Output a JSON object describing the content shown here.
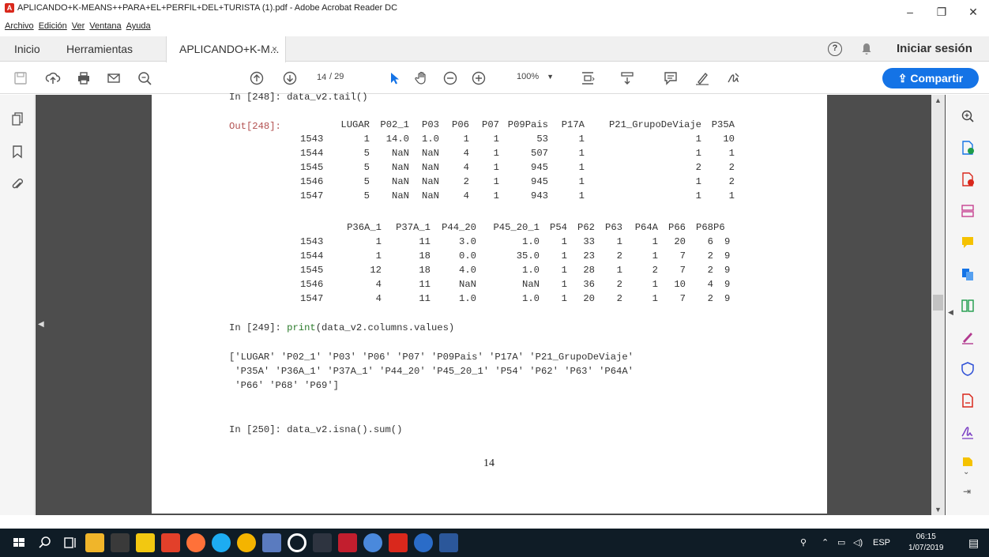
{
  "window": {
    "title": "APLICANDO+K-MEANS++PARA+EL+PERFIL+DEL+TURISTA (1).pdf - Adobe Acrobat Reader DC",
    "minimize": "–",
    "restore": "❐",
    "close": "✕"
  },
  "menu": [
    "Archivo",
    "Edición",
    "Ver",
    "Ventana",
    "Ayuda"
  ],
  "tabs": {
    "home": "Inicio",
    "tools": "Herramientas",
    "document": "APLICANDO+K-M...",
    "document_close": "×",
    "signin": "Iniciar sesión",
    "help": "?"
  },
  "toolbar": {
    "current_page": "14",
    "total_pages": "/ 29",
    "zoom": "100%",
    "share": "Compartir"
  },
  "document": {
    "line_tail_partial": "In [248]: data_v2.tail()",
    "out_label": "Out[248]:",
    "table1": {
      "headers": [
        "",
        "LUGAR",
        "P02_1",
        "P03",
        "P06",
        "P07",
        "P09Pais",
        "P17A",
        "P21_GrupoDeViaje",
        "P35A"
      ],
      "rows": [
        [
          "1543",
          "1",
          "14.0",
          "1.0",
          "1",
          "1",
          "53",
          "1",
          "1",
          "10"
        ],
        [
          "1544",
          "5",
          "NaN",
          "NaN",
          "4",
          "1",
          "507",
          "1",
          "1",
          "1"
        ],
        [
          "1545",
          "5",
          "NaN",
          "NaN",
          "4",
          "1",
          "945",
          "1",
          "2",
          "2"
        ],
        [
          "1546",
          "5",
          "NaN",
          "NaN",
          "2",
          "1",
          "945",
          "1",
          "1",
          "2"
        ],
        [
          "1547",
          "5",
          "NaN",
          "NaN",
          "4",
          "1",
          "943",
          "1",
          "1",
          "1"
        ]
      ]
    },
    "table2": {
      "headers": [
        "",
        "P36A_1",
        "P37A_1",
        "P44_20",
        "P45_20_1",
        "P54",
        "P62",
        "P63",
        "P64A",
        "P66",
        "P68",
        "P6"
      ],
      "rows": [
        [
          "1543",
          "1",
          "11",
          "3.0",
          "1.0",
          "1",
          "33",
          "1",
          "1",
          "20",
          "6",
          "9"
        ],
        [
          "1544",
          "1",
          "18",
          "0.0",
          "35.0",
          "1",
          "23",
          "2",
          "1",
          "7",
          "2",
          "9"
        ],
        [
          "1545",
          "12",
          "18",
          "4.0",
          "1.0",
          "1",
          "28",
          "1",
          "2",
          "7",
          "2",
          "9"
        ],
        [
          "1546",
          "4",
          "11",
          "NaN",
          "NaN",
          "1",
          "36",
          "2",
          "1",
          "10",
          "4",
          "9"
        ],
        [
          "1547",
          "4",
          "11",
          "1.0",
          "1.0",
          "1",
          "20",
          "2",
          "1",
          "7",
          "2",
          "9"
        ]
      ]
    },
    "in249_prefix": "In [249]: ",
    "in249_func": "print",
    "in249_rest": "(data_v2.columns.values)",
    "columns_line1": "['LUGAR' 'P02_1' 'P03' 'P06' 'P07' 'P09Pais' 'P17A' 'P21_GrupoDeViaje'",
    "columns_line2": " 'P35A' 'P36A_1' 'P37A_1' 'P44_20' 'P45_20_1' 'P54' 'P62' 'P63' 'P64A'",
    "columns_line3": " 'P66' 'P68' 'P69']",
    "in250": "In [250]: data_v2.isna().sum()",
    "page_number": "14"
  },
  "taskbar": {
    "lang": "ESP",
    "time": "06:15",
    "date": "1/07/2019"
  },
  "colors": {
    "accent": "#1473e6",
    "adobe_red": "#d9281c",
    "taskbar": "#0f1c26"
  }
}
